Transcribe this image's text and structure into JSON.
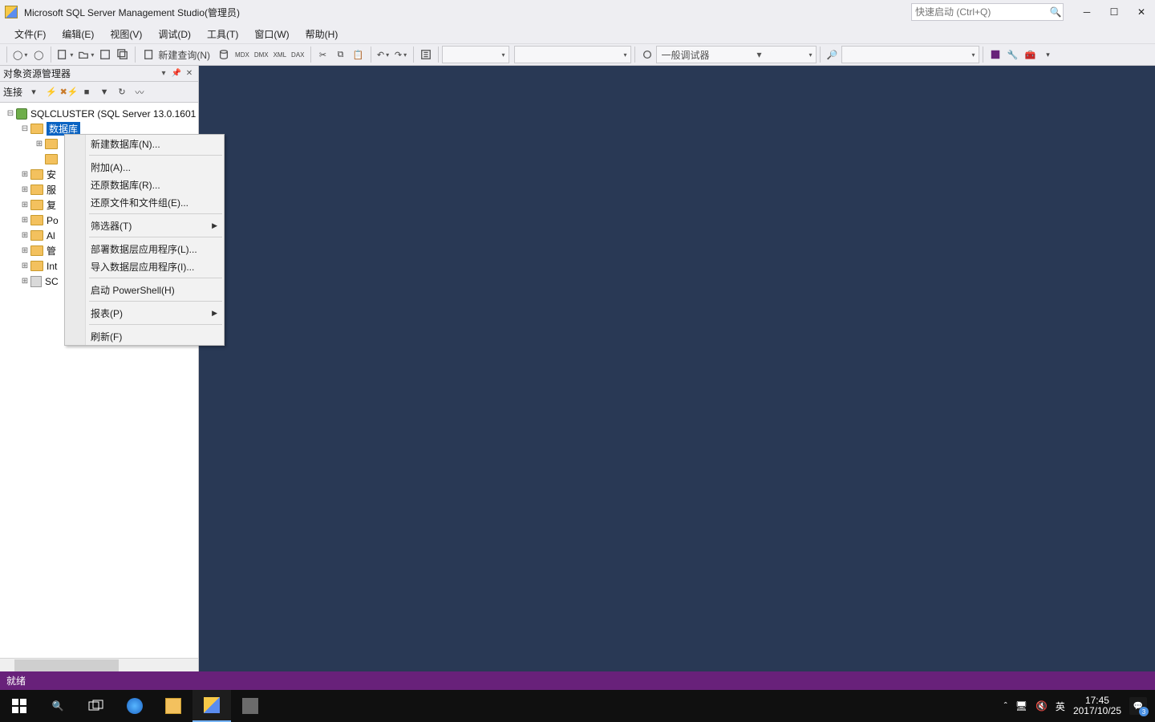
{
  "title": "Microsoft SQL Server Management Studio(管理员)",
  "quicklaunch_placeholder": "快速启动 (Ctrl+Q)",
  "menubar": [
    "文件(F)",
    "编辑(E)",
    "视图(V)",
    "调试(D)",
    "工具(T)",
    "窗口(W)",
    "帮助(H)"
  ],
  "toolbar": {
    "new_query": "新建查询(N)",
    "debugger_combo": "一般调试器"
  },
  "object_explorer": {
    "title": "对象资源管理器",
    "connect_label": "连接",
    "server": "SQLCLUSTER (SQL Server 13.0.1601",
    "selected_node": "数据库",
    "folders": [
      "安",
      "服",
      "复",
      "Po",
      "Al",
      "管",
      "Int",
      "SC"
    ]
  },
  "context_menu": {
    "items": [
      {
        "label": "新建数据库(N)...",
        "sub": false
      },
      {
        "sep": true
      },
      {
        "label": "附加(A)...",
        "sub": false
      },
      {
        "label": "还原数据库(R)...",
        "sub": false
      },
      {
        "label": "还原文件和文件组(E)...",
        "sub": false
      },
      {
        "sep": true
      },
      {
        "label": "筛选器(T)",
        "sub": true
      },
      {
        "sep": true
      },
      {
        "label": "部署数据层应用程序(L)...",
        "sub": false
      },
      {
        "label": "导入数据层应用程序(I)...",
        "sub": false
      },
      {
        "sep": true
      },
      {
        "label": "启动 PowerShell(H)",
        "sub": false
      },
      {
        "sep": true
      },
      {
        "label": "报表(P)",
        "sub": true
      },
      {
        "sep": true
      },
      {
        "label": "刷新(F)",
        "sub": false
      }
    ]
  },
  "status": "就绪",
  "tray": {
    "ime": "英",
    "time": "17:45",
    "date": "2017/10/25",
    "notif_count": "3"
  }
}
